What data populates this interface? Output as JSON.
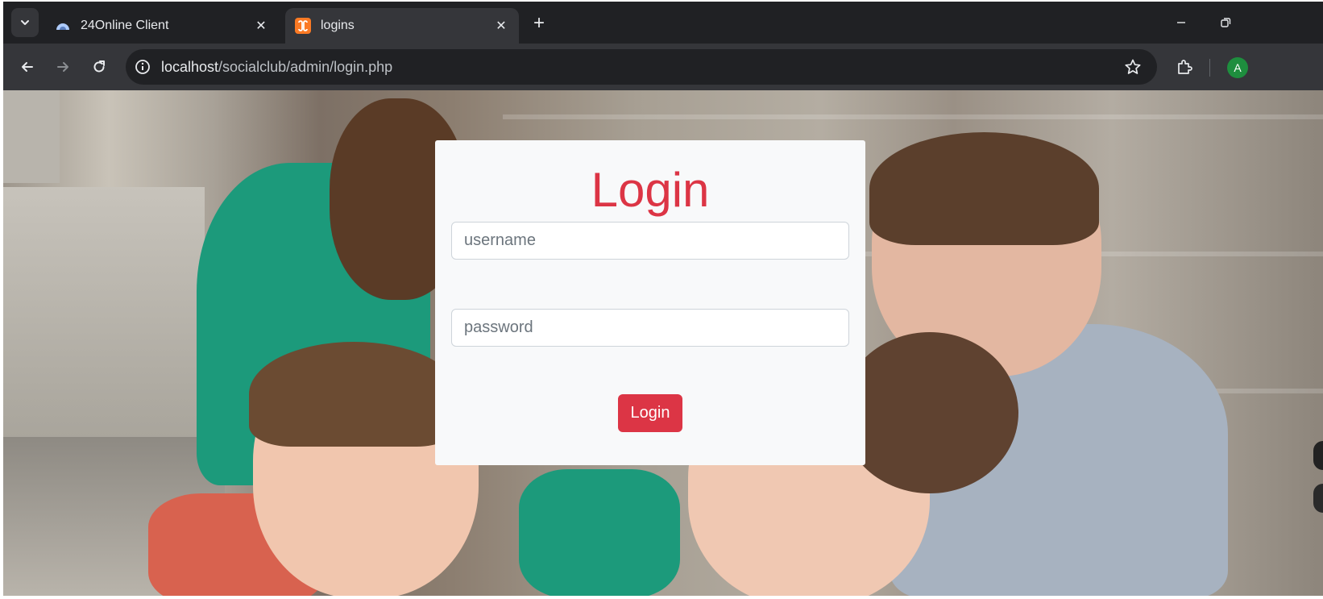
{
  "browser": {
    "tabs": [
      {
        "title": "24Online Client",
        "active": false,
        "favicon": "cloud-icon"
      },
      {
        "title": "logins",
        "active": true,
        "favicon": "xampp-icon"
      }
    ],
    "close_symbol": "✕",
    "new_tab_symbol": "+",
    "address": {
      "host": "localhost",
      "path": "/socialclub/admin/login.php"
    },
    "profile_initial": "A"
  },
  "login": {
    "heading": "Login",
    "username_placeholder": "username",
    "password_placeholder": "password",
    "button_label": "Login"
  },
  "colors": {
    "accent": "#dc3545",
    "card_background": "#f8f9fa",
    "browser_chrome": "#202124"
  }
}
